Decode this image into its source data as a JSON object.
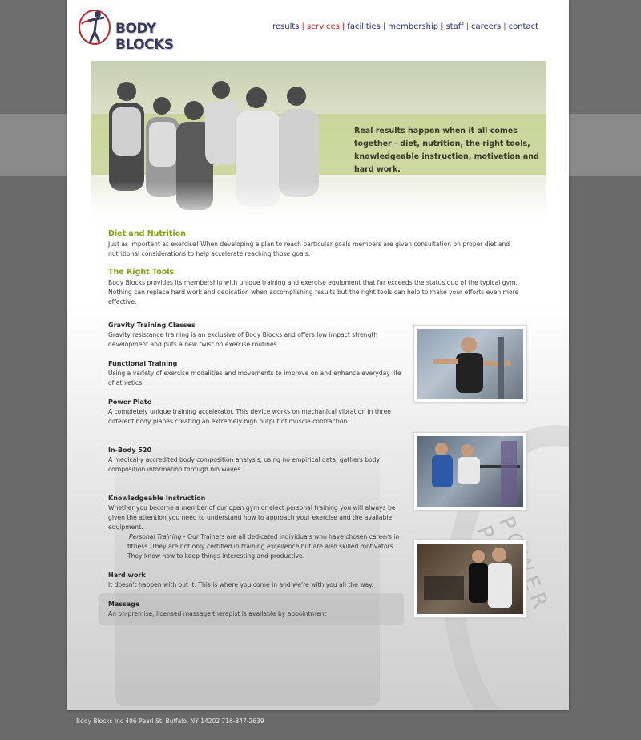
{
  "brand": {
    "name": "BODY BLOCKS",
    "accent": "#c0262b",
    "nav_color": "#2b2b6b",
    "green": "#8aa018"
  },
  "nav": {
    "items": [
      {
        "label": "results",
        "active": false
      },
      {
        "label": "services",
        "active": true
      },
      {
        "label": "facilities",
        "active": false
      },
      {
        "label": "membership",
        "active": false
      },
      {
        "label": "staff",
        "active": false
      },
      {
        "label": "careers",
        "active": false
      },
      {
        "label": "contact",
        "active": false
      }
    ]
  },
  "hero": {
    "tagline": "Real results happen when it all comes together - diet, nutrition, the right tools, knowledgeable instruction, motivation and hard work."
  },
  "sections": {
    "diet": {
      "title": "Diet and Nutrition",
      "text": "Just as important as exercise! When developing a plan to reach particular goals members are given consultation on proper diet and nutritional considerations to help accelerate reaching those goals."
    },
    "tools": {
      "title": "The Right Tools",
      "text": "Body Blocks provides its membership with unique training and exercise equipment that far exceeds the status quo of the typical gym. Nothing can replace hard work and dedication when accomplishing results but the right tools can help to make your efforts even more effective."
    },
    "gravity": {
      "title": "Gravity Training Classes",
      "text": "Gravity resistance training is an exclusive of Body Blocks and offers low impact strength development and puts a new twist on exercise routines"
    },
    "functional": {
      "title": "Functional Training",
      "text": "Using a variety of exercise modalities and movements to improve on and enhance everyday life of athletics."
    },
    "powerplate": {
      "title": "Power Plate",
      "text": "A completely unique training accelerator.  This device works on mechanical vibration in three different body planes creating an extremely high output of muscle contraction."
    },
    "inbody": {
      "title": "In-Body 520",
      "text": "A medically accredited body composition analysis, using no empirical data, gathers body composition information through bio waves."
    },
    "knowledge": {
      "title": "Knowledgeable Instruction",
      "text": "Whether you become a member of our open gym or elect personal training you will always be given the attention you need to understand how to approach your exercise and the available equipment.",
      "sub_italic": "Personal Training",
      "sub_text": " - Our Trainers are all dedicated individuals who have chosen careers in fitness. They are not only certified in training excellence but are also skilled motivators. They know how to keep things interesting and productive."
    },
    "hardwork": {
      "title": "Hard work",
      "text": "It doesn't happen with out it. This is where you come in and we're with you all the way."
    },
    "massage": {
      "title": "Massage",
      "text": "An on-premise, licensed massage therapist is available by appointment"
    }
  },
  "background": {
    "watermark": "POWER PLATE"
  },
  "footer": {
    "address": "Body Blocks Inc 496 Pearl St. Buffalo, NY 14202 716-847-2639"
  }
}
